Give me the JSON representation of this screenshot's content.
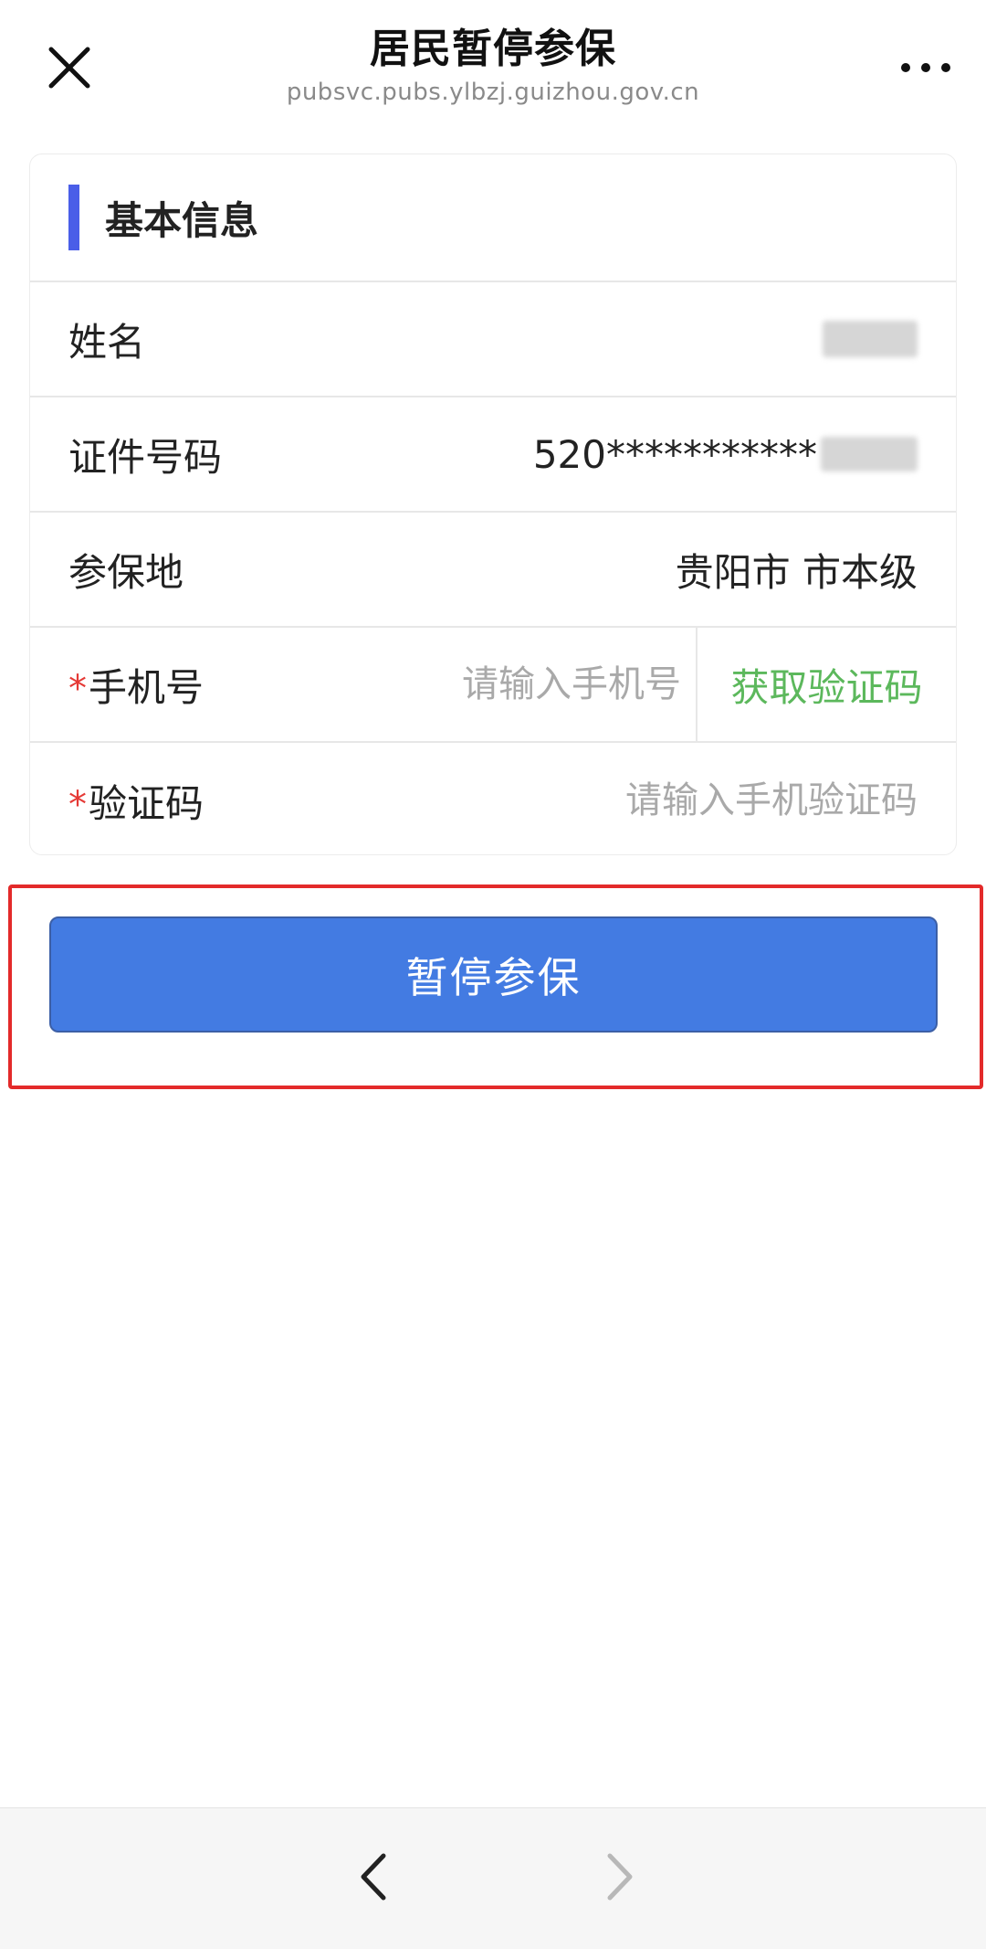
{
  "navbar": {
    "title": "居民暂停参保",
    "url": "pubsvc.pubs.ylbzj.guizhou.gov.cn",
    "close_icon": "close-icon",
    "more_icon": "more-dots-icon"
  },
  "card": {
    "section_title": "基本信息",
    "accent_color": "#4A5EE8",
    "rows": {
      "name": {
        "label": "姓名",
        "value_redacted": true
      },
      "id_number": {
        "label": "证件号码",
        "value_prefix": "520***********",
        "value_redacted_suffix": true
      },
      "location": {
        "label": "参保地",
        "value": "贵阳市 市本级"
      },
      "phone": {
        "required_mark": "*",
        "label": "手机号",
        "placeholder": "请输入手机号",
        "sms_button_label": "获取验证码"
      },
      "code": {
        "required_mark": "*",
        "label": "验证码",
        "placeholder": "请输入手机验证码"
      }
    }
  },
  "action": {
    "submit_label": "暂停参保",
    "button_color": "#437BE2",
    "highlight_color": "#e32a2a"
  },
  "bottom_bar": {
    "back_icon": "chevron-left-icon",
    "forward_icon": "chevron-right-icon",
    "forward_enabled": false
  }
}
